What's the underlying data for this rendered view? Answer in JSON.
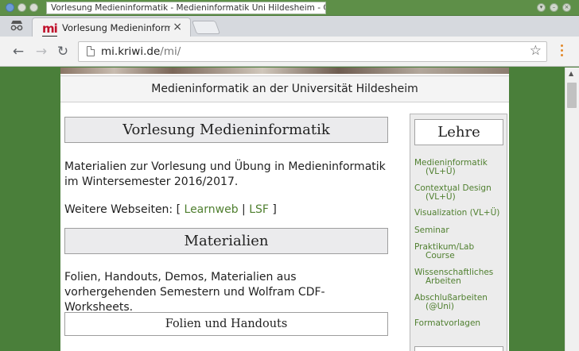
{
  "window": {
    "title": "Vorlesung Medieninformatik - Medieninformatik Uni Hildesheim - Chromium",
    "controls": [
      "▾",
      "–",
      "×"
    ]
  },
  "tabs": [
    {
      "favicon_text": "mi",
      "label": "Vorlesung Medieninformat",
      "close": "×"
    }
  ],
  "toolbar": {
    "back": "←",
    "forward": "→",
    "reload": "↻",
    "url_host": "mi.kriwi.de",
    "url_path": "/mi/",
    "star": "☆"
  },
  "page": {
    "site_header": "Medieninformatik an der Universität Hildesheim",
    "heading_main": "Vorlesung Medieninformatik",
    "intro": "Materialien zur Vorlesung und Übung in Medieninformatik im Wintersemester 2016/2017.",
    "links_prefix": "Weitere Webseiten: [ ",
    "link_learnweb": "Learnweb",
    "links_sep": " | ",
    "link_lsf": "LSF",
    "links_suffix": " ]",
    "heading_materialien": "Materialien",
    "materialien_text": "Folien, Handouts, Demos, Materialien aus vorhergehenden Semestern und Wolfram CDF-Worksheets.",
    "heading_folien": "Folien und Handouts"
  },
  "sidebar": {
    "title": "Lehre",
    "items": [
      {
        "line1": "Medieninformatik",
        "line2": "(VL+Ü)"
      },
      {
        "line1": "Contextual Design",
        "line2": "(VL+Ü)"
      },
      {
        "line1": "Visualization (VL+Ü)",
        "line2": ""
      },
      {
        "line1": "Seminar",
        "line2": ""
      },
      {
        "line1": "Praktikum/Lab",
        "line2": "Course"
      },
      {
        "line1": "Wissenschaftliches",
        "line2": "Arbeiten"
      },
      {
        "line1": "Abschlußarbeiten",
        "line2": "(@Uni)"
      },
      {
        "line1": "Formatvorlagen",
        "line2": ""
      }
    ]
  }
}
